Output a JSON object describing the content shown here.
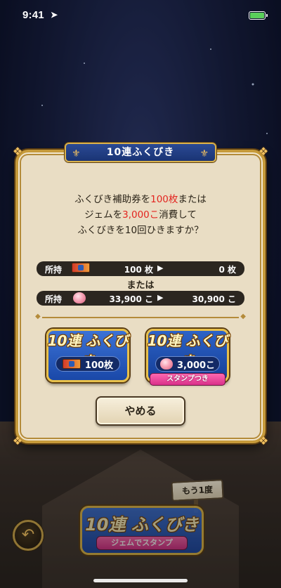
{
  "status_bar": {
    "time": "9:41"
  },
  "dialog": {
    "title": "10連ふくびき",
    "message": {
      "line1_a": "ふくびき補助券を",
      "line1_b": "100枚",
      "line1_c": "または",
      "line2_a": "ジェムを",
      "line2_b": "3,000こ",
      "line2_c": "消費して",
      "line3": "ふくびきを10回ひきますか？"
    },
    "holding_label": "所持",
    "or_text": "または",
    "tickets": {
      "current": "100 枚",
      "after": "0 枚"
    },
    "gems": {
      "current": "33,900 こ",
      "after": "30,900 こ"
    },
    "ticket_button": {
      "title": "10連 ふくびき",
      "cost": "100枚"
    },
    "gem_button": {
      "title": "10連 ふくびき",
      "cost": "3,000こ",
      "ribbon": "スタンプつき"
    },
    "cancel_label": "やめる"
  },
  "background": {
    "sign": "もう1度",
    "bottom_button": {
      "title": "10連 ふくびき",
      "sub": "ジェムでスタンプ"
    }
  },
  "colors": {
    "highlight_red": "#e3241f",
    "dialog_bg": "#e9ddc4",
    "gold_border": "#c69a3a",
    "button_blue": "#1a48a8"
  },
  "icons": [
    "location-arrow-icon",
    "battery-icon",
    "ticket-icon",
    "gem-icon",
    "back-arrow-icon",
    "triangle-arrow-icon"
  ]
}
